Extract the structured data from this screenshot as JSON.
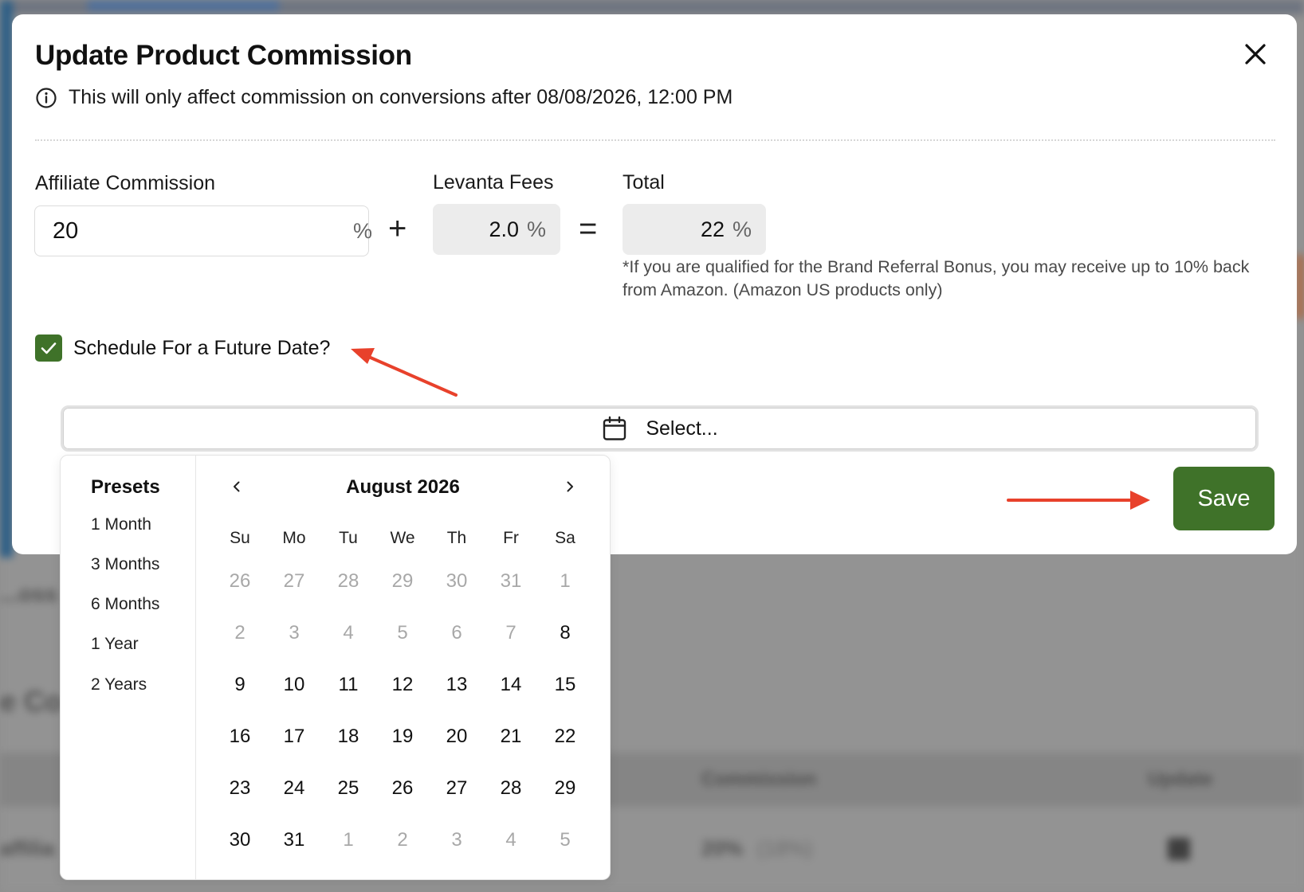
{
  "background": {
    "heading1": "...oss",
    "heading2": "e Co",
    "table_headers": [
      "Commission",
      "Update"
    ],
    "row": {
      "name": "affilia",
      "commission": "20%",
      "commission_old": "(18%)"
    }
  },
  "modal": {
    "title": "Update Product Commission",
    "info_text": "This will only affect commission on conversions after 08/08/2026, 12:00 PM",
    "affiliate_label": "Affiliate Commission",
    "affiliate_value": "20",
    "fees_label": "Levanta Fees",
    "fees_value": "2.0",
    "total_label": "Total",
    "total_value": "22",
    "percent_symbol": "%",
    "plus": "+",
    "equals": "=",
    "footnote": "*If you are qualified for the Brand Referral Bonus, you may receive up to 10% back from Amazon. (Amazon US products only)",
    "schedule_label": "Schedule For a Future Date?",
    "schedule_checked": true,
    "date_select_placeholder": "Select...",
    "save_label": "Save"
  },
  "datepicker": {
    "presets_title": "Presets",
    "presets": [
      "1 Month",
      "3 Months",
      "6 Months",
      "1 Year",
      "2 Years"
    ],
    "month_label": "August 2026",
    "weekdays": [
      "Su",
      "Mo",
      "Tu",
      "We",
      "Th",
      "Fr",
      "Sa"
    ],
    "days": [
      {
        "d": "26",
        "muted": true
      },
      {
        "d": "27",
        "muted": true
      },
      {
        "d": "28",
        "muted": true
      },
      {
        "d": "29",
        "muted": true
      },
      {
        "d": "30",
        "muted": true
      },
      {
        "d": "31",
        "muted": true
      },
      {
        "d": "1",
        "muted": true
      },
      {
        "d": "2",
        "muted": true
      },
      {
        "d": "3",
        "muted": true
      },
      {
        "d": "4",
        "muted": true
      },
      {
        "d": "5",
        "muted": true
      },
      {
        "d": "6",
        "muted": true
      },
      {
        "d": "7",
        "muted": true
      },
      {
        "d": "8",
        "muted": false
      },
      {
        "d": "9",
        "muted": false
      },
      {
        "d": "10",
        "muted": false
      },
      {
        "d": "11",
        "muted": false
      },
      {
        "d": "12",
        "muted": false
      },
      {
        "d": "13",
        "muted": false
      },
      {
        "d": "14",
        "muted": false
      },
      {
        "d": "15",
        "muted": false
      },
      {
        "d": "16",
        "muted": false
      },
      {
        "d": "17",
        "muted": false
      },
      {
        "d": "18",
        "muted": false
      },
      {
        "d": "19",
        "muted": false
      },
      {
        "d": "20",
        "muted": false
      },
      {
        "d": "21",
        "muted": false
      },
      {
        "d": "22",
        "muted": false
      },
      {
        "d": "23",
        "muted": false
      },
      {
        "d": "24",
        "muted": false
      },
      {
        "d": "25",
        "muted": false
      },
      {
        "d": "26",
        "muted": false
      },
      {
        "d": "27",
        "muted": false
      },
      {
        "d": "28",
        "muted": false
      },
      {
        "d": "29",
        "muted": false
      },
      {
        "d": "30",
        "muted": false
      },
      {
        "d": "31",
        "muted": false
      },
      {
        "d": "1",
        "muted": true
      },
      {
        "d": "2",
        "muted": true
      },
      {
        "d": "3",
        "muted": true
      },
      {
        "d": "4",
        "muted": true
      },
      {
        "d": "5",
        "muted": true
      }
    ]
  },
  "colors": {
    "accent_green": "#3f7229",
    "annotation_red": "#e8412b",
    "overlay_gray": "#939393"
  },
  "icons": [
    "close-icon",
    "info-icon",
    "check-icon",
    "calendar-icon",
    "chevron-left-icon",
    "chevron-right-icon"
  ]
}
